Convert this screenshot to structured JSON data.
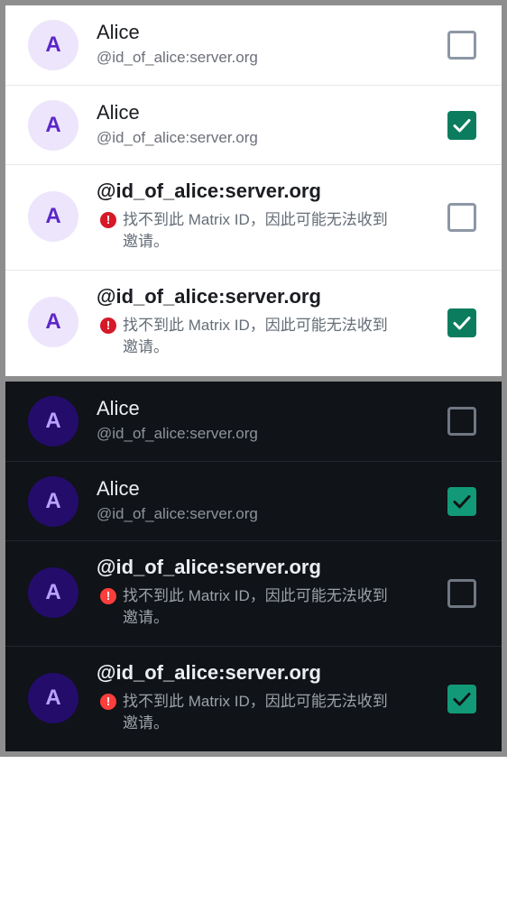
{
  "colors": {
    "light_background": "#ffffff",
    "dark_background": "#101317",
    "frame": "#8e8e8e",
    "accent_check_light": "#0b7d5e",
    "accent_check_dark": "#129a78",
    "avatar_light_bg": "#ede5fb",
    "avatar_light_text": "#5b26c9",
    "avatar_dark_bg": "#240c6a",
    "avatar_dark_text": "#b9a2ff",
    "warning_red": "#d51928"
  },
  "icons": {
    "warning": "error-circle-icon",
    "check": "checkmark-icon"
  },
  "light_list": [
    {
      "avatar": "A",
      "name": "Alice",
      "handle": "@id_of_alice:server.org",
      "selected": false
    },
    {
      "avatar": "A",
      "name": "Alice",
      "handle": "@id_of_alice:server.org",
      "selected": true
    },
    {
      "avatar": "A",
      "name": "@id_of_alice:server.org",
      "warning_icon": "!",
      "warning": "找不到此 Matrix ID，因此可能无法收到邀请。",
      "selected": false
    },
    {
      "avatar": "A",
      "name": "@id_of_alice:server.org",
      "warning_icon": "!",
      "warning": "找不到此 Matrix ID，因此可能无法收到邀请。",
      "selected": true
    }
  ],
  "dark_list": [
    {
      "avatar": "A",
      "name": "Alice",
      "handle": "@id_of_alice:server.org",
      "selected": false
    },
    {
      "avatar": "A",
      "name": "Alice",
      "handle": "@id_of_alice:server.org",
      "selected": true
    },
    {
      "avatar": "A",
      "name": "@id_of_alice:server.org",
      "warning_icon": "!",
      "warning": "找不到此 Matrix ID，因此可能无法收到邀请。",
      "selected": false
    },
    {
      "avatar": "A",
      "name": "@id_of_alice:server.org",
      "warning_icon": "!",
      "warning": "找不到此 Matrix ID，因此可能无法收到邀请。",
      "selected": true
    }
  ]
}
